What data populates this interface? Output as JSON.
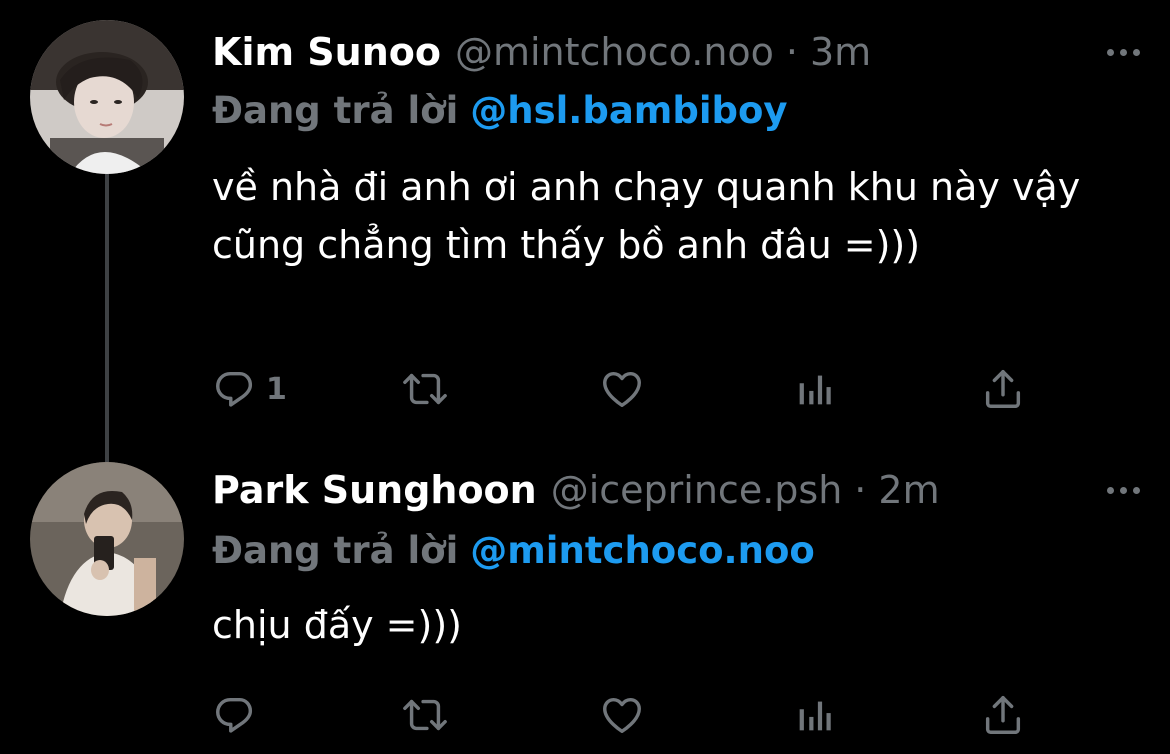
{
  "colors": {
    "background": "#000000",
    "text": "#ffffff",
    "muted": "#71767b",
    "link": "#1d9bf0",
    "thread_line": "#3e4144"
  },
  "icons": {
    "reply": "speech-bubble",
    "retweet": "retweet-arrows",
    "like": "heart-outline",
    "stats": "bar-chart",
    "share": "share-arrow-up",
    "more": "horizontal-ellipsis"
  },
  "tweets": [
    {
      "name": "Kim Sunoo",
      "handle": "@mintchoco.noo",
      "separator": "·",
      "time": "3m",
      "reply_prefix": "Đang trả lời",
      "reply_to": "@hsl.bambiboy",
      "text": "về nhà đi anh ơi anh chạy quanh khu này vậy cũng chẳng tìm thấy bồ anh đâu =)))",
      "reply_count": "1"
    },
    {
      "name": "Park Sunghoon",
      "handle": "@iceprince.psh",
      "separator": "·",
      "time": "2m",
      "reply_prefix": "Đang trả lời",
      "reply_to": "@mintchoco.noo",
      "text": "chịu đấy =)))",
      "reply_count": ""
    }
  ]
}
